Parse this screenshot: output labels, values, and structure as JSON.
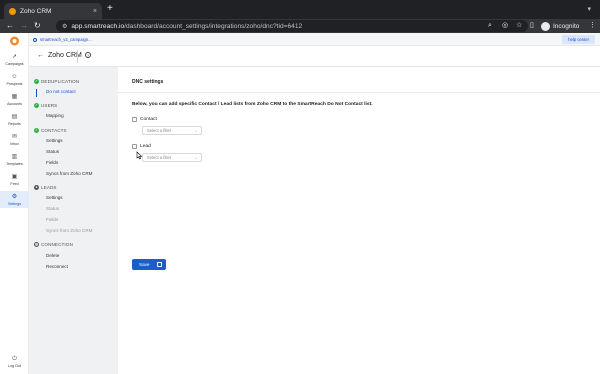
{
  "browser": {
    "tab_title": "Zoho CRM",
    "tab_close": "×",
    "new_tab": "+",
    "url_host": "app.smartreach.io",
    "url_path": "/dashboard/account_settings/integrations/zoho/dnc?tid=6412",
    "profile_label": "Incognito"
  },
  "topbar": {
    "breadcrumb": "smartreach_v2_campaign...",
    "help_label": "help center"
  },
  "rail": {
    "items": [
      {
        "label": "Campaigns",
        "icon": "rocket-icon",
        "glyph": "➚"
      },
      {
        "label": "Prospects",
        "icon": "people-icon",
        "glyph": "☺"
      },
      {
        "label": "Accounts",
        "icon": "building-icon",
        "glyph": "▦"
      },
      {
        "label": "Reports",
        "icon": "chart-icon",
        "glyph": "▤"
      },
      {
        "label": "Inbox",
        "icon": "mail-icon",
        "glyph": "✉"
      },
      {
        "label": "Templates",
        "icon": "template-icon",
        "glyph": "▥"
      },
      {
        "label": "Feed",
        "icon": "feed-icon",
        "glyph": "▣"
      },
      {
        "label": "Settings",
        "icon": "gear-icon",
        "glyph": "⚙"
      }
    ],
    "logout_label": "Log Out",
    "active_color": "#1a4fc6"
  },
  "header": {
    "title": "Zoho CRM",
    "back_glyph": "←",
    "help_glyph": "?"
  },
  "subnav": {
    "sections": [
      {
        "title": "DEDUPLICATION",
        "items": [
          "Do not contact"
        ]
      },
      {
        "title": "USERS",
        "items": [
          "Mapping"
        ]
      },
      {
        "title": "CONTACTS",
        "items": [
          "Settings",
          "Status",
          "Fields",
          "Syncs from Zoho CRM"
        ]
      },
      {
        "title": "LEADS",
        "items": [
          "Settings",
          "Status",
          "Fields",
          "Syncs from Zoho CRM"
        ]
      },
      {
        "title": "CONNECTION",
        "items": [
          "Delete",
          "Reconnect"
        ]
      }
    ],
    "active_item": "Do not contact"
  },
  "main": {
    "title": "DNC settings",
    "description": "Below, you can add specific Contact / Lead lists from Zoho CRM to the SmartReach Do Not Contact list.",
    "contact_label": "Contact",
    "lead_label": "Lead",
    "filter_placeholder": "Select a filter",
    "save_label": "Save"
  },
  "colors": {
    "primary": "#1a5fc7",
    "success": "#2fb344",
    "sidebar_bg": "#f0f1f3"
  }
}
